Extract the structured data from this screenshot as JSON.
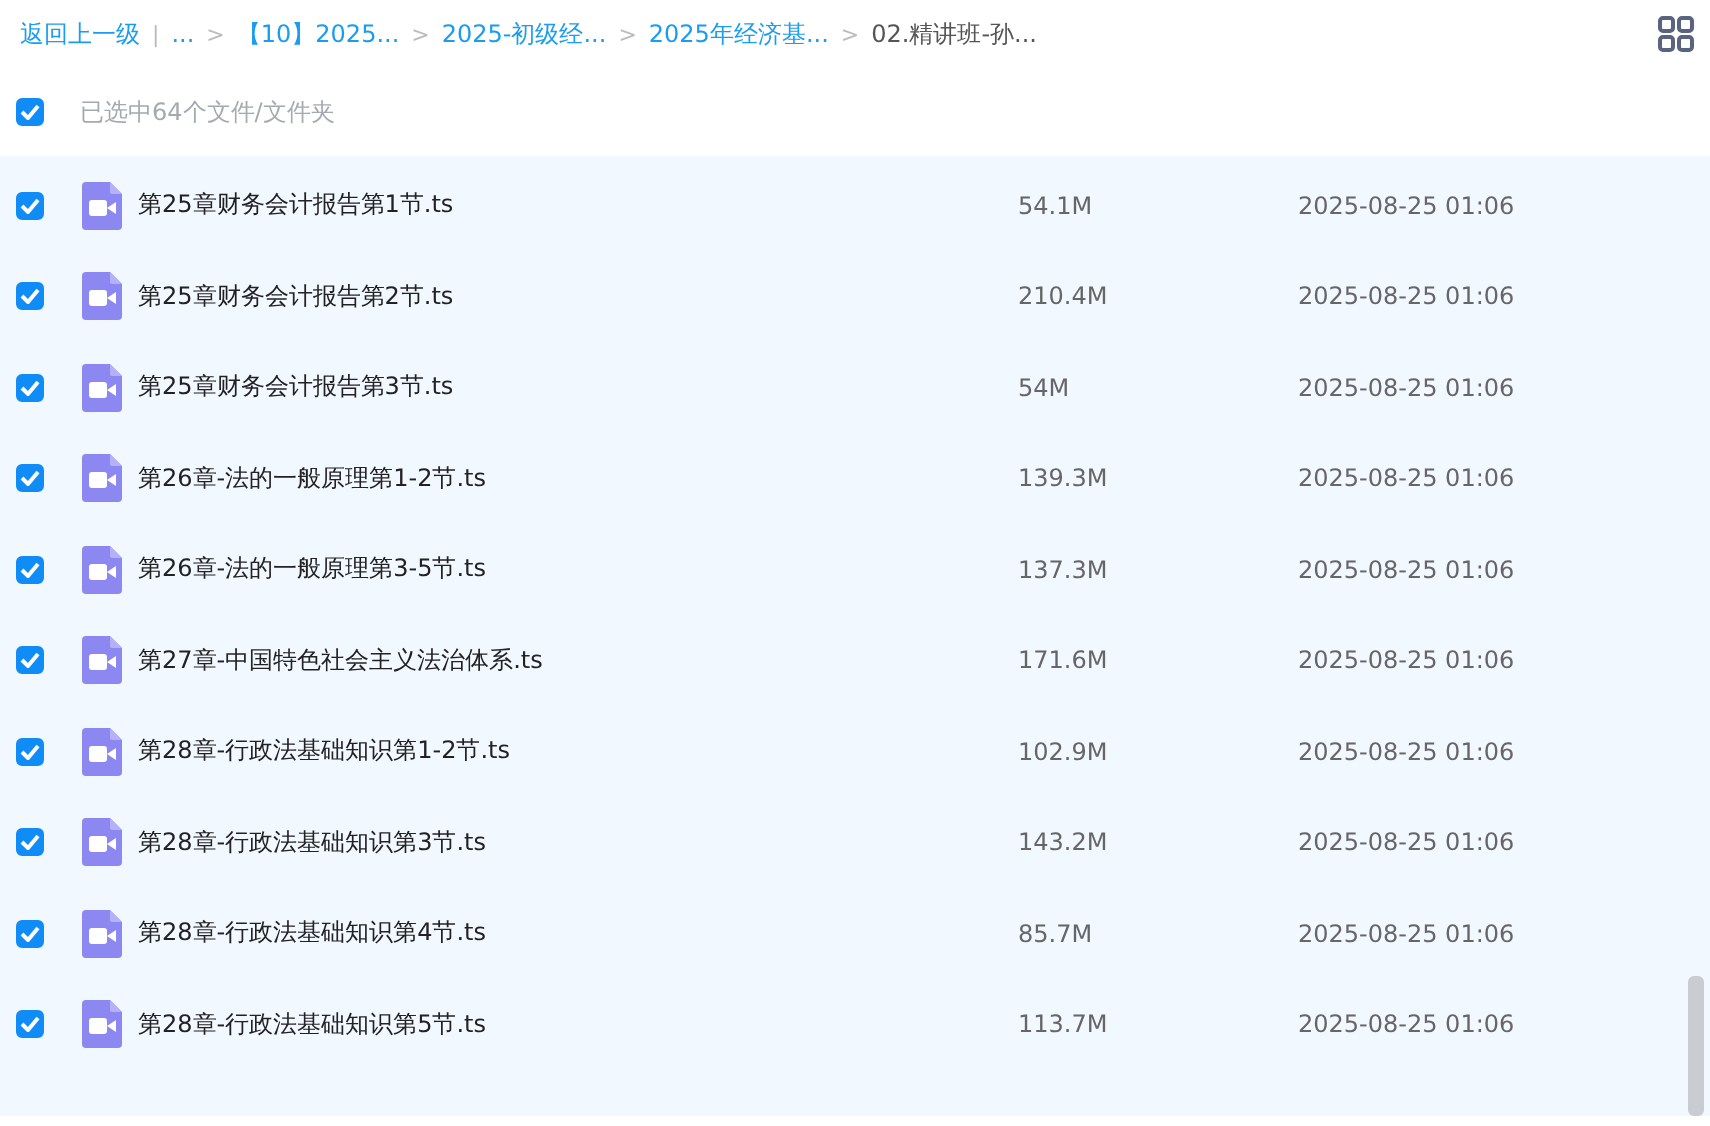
{
  "breadcrumb": {
    "back": "返回上一级",
    "divider": "|",
    "ellipsis": "...",
    "items": [
      {
        "separator": ">",
        "label": "【10】2025...",
        "current": false
      },
      {
        "separator": ">",
        "label": "2025-初级经...",
        "current": false
      },
      {
        "separator": ">",
        "label": "2025年经济基...",
        "current": false
      },
      {
        "separator": ">",
        "label": "02.精讲班-孙...",
        "current": true
      }
    ]
  },
  "selection": {
    "checked": true,
    "label": "已选中64个文件/文件夹"
  },
  "files": [
    {
      "name": "第25章财务会计报告第1节.ts",
      "size": "54.1M",
      "modified": "2025-08-25 01:06",
      "checked": true
    },
    {
      "name": "第25章财务会计报告第2节.ts",
      "size": "210.4M",
      "modified": "2025-08-25 01:06",
      "checked": true
    },
    {
      "name": "第25章财务会计报告第3节.ts",
      "size": "54M",
      "modified": "2025-08-25 01:06",
      "checked": true
    },
    {
      "name": "第26章-法的一般原理第1-2节.ts",
      "size": "139.3M",
      "modified": "2025-08-25 01:06",
      "checked": true
    },
    {
      "name": "第26章-法的一般原理第3-5节.ts",
      "size": "137.3M",
      "modified": "2025-08-25 01:06",
      "checked": true
    },
    {
      "name": "第27章-中国特色社会主义法治体系.ts",
      "size": "171.6M",
      "modified": "2025-08-25 01:06",
      "checked": true
    },
    {
      "name": "第28章-行政法基础知识第1-2节.ts",
      "size": "102.9M",
      "modified": "2025-08-25 01:06",
      "checked": true
    },
    {
      "name": "第28章-行政法基础知识第3节.ts",
      "size": "143.2M",
      "modified": "2025-08-25 01:06",
      "checked": true
    },
    {
      "name": "第28章-行政法基础知识第4节.ts",
      "size": "85.7M",
      "modified": "2025-08-25 01:06",
      "checked": true
    },
    {
      "name": "第28章-行政法基础知识第5节.ts",
      "size": "113.7M",
      "modified": "2025-08-25 01:06",
      "checked": true
    }
  ]
}
